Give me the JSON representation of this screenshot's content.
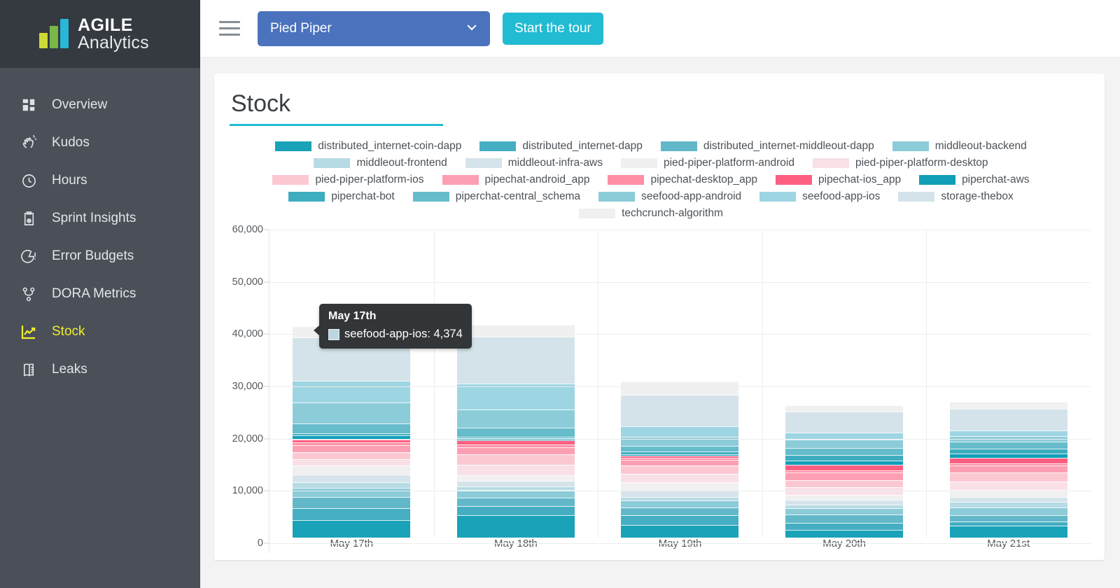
{
  "brand": {
    "line1": "AGILE",
    "line2": "Analytics"
  },
  "sidebar": {
    "items": [
      {
        "label": "Overview",
        "icon": "dashboard-icon",
        "active": false
      },
      {
        "label": "Kudos",
        "icon": "clap-icon",
        "active": false
      },
      {
        "label": "Hours",
        "icon": "clock-icon",
        "active": false
      },
      {
        "label": "Sprint Insights",
        "icon": "clipboard-icon",
        "active": false
      },
      {
        "label": "Error Budgets",
        "icon": "pie-alert-icon",
        "active": false
      },
      {
        "label": "DORA Metrics",
        "icon": "git-branch-icon",
        "active": false
      },
      {
        "label": "Stock",
        "icon": "trend-up-icon",
        "active": true
      },
      {
        "label": "Leaks",
        "icon": "book-icon",
        "active": false
      }
    ]
  },
  "topbar": {
    "menu_icon": "hamburger-icon",
    "project_selected": "Pied Piper",
    "project_chevron": "∨",
    "tour_label": "Start the tour"
  },
  "colors": {
    "accent": "#21bbd2",
    "project_select_bg": "#4a72bd",
    "sidebar_bg": "#4a4f58",
    "brand_bg": "#343a40",
    "active_nav": "#f1ef2c"
  },
  "tooltip": {
    "title": "May 17th",
    "series": "seefood-app-ios",
    "value": "4,374",
    "text": "seefood-app-ios: 4,374",
    "swatch": "#bcd7e0"
  },
  "chart_data": {
    "type": "bar",
    "stacked": true,
    "title": "Stock",
    "xlabel": "",
    "ylabel": "",
    "ylim": [
      0,
      60000
    ],
    "yticks": [
      0,
      10000,
      20000,
      30000,
      40000,
      50000,
      60000
    ],
    "ytick_labels": [
      "0",
      "10,000",
      "20,000",
      "30,000",
      "40,000",
      "50,000",
      "60,000"
    ],
    "grid": true,
    "legend_position": "top",
    "categories": [
      "May 17th",
      "May 18th",
      "May 19th",
      "May 20th",
      "May 21st"
    ],
    "series": [
      {
        "name": "distributed_internet-coin-dapp",
        "color": "#19a2b8",
        "values": [
          3480,
          4550,
          2500,
          1560,
          2420
        ]
      },
      {
        "name": "distributed_internet-dapp",
        "color": "#45aec2",
        "values": [
          2350,
          1740,
          2020,
          1290,
          800
        ]
      },
      {
        "name": "distributed_internet-middleout-dapp",
        "color": "#62b8c8",
        "values": [
          2120,
          1560,
          1500,
          1640,
          1180
        ]
      },
      {
        "name": "middleout-backend",
        "color": "#8ccbd8",
        "values": [
          1830,
          1430,
          1250,
          1280,
          1560
        ]
      },
      {
        "name": "middleout-frontend",
        "color": "#b6dbe5",
        "values": [
          980,
          620,
          620,
          640,
          980
        ]
      },
      {
        "name": "middleout-infra-aws",
        "color": "#d4e4ea",
        "values": [
          1420,
          1020,
          1240,
          800,
          960
        ]
      },
      {
        "name": "pied-piper-platform-android",
        "color": "#f0f0f0",
        "values": [
          1720,
          1080,
          1600,
          920,
          1260
        ]
      },
      {
        "name": "pied-piper-platform-desktop",
        "color": "#f9e0e6",
        "values": [
          1250,
          2020,
          1620,
          1540,
          1720
        ]
      },
      {
        "name": "pied-piper-platform-ios",
        "color": "#fbc8d2",
        "values": [
          1250,
          1990,
          1680,
          1460,
          1760
        ]
      },
      {
        "name": "pipechat-android_app",
        "color": "#fd9fb2",
        "values": [
          1300,
          1310,
          1080,
          1420,
          1420
        ]
      },
      {
        "name": "pipechat-desktop_app",
        "color": "#fe8fa5",
        "values": [
          420,
          470,
          230,
          300,
          290
        ]
      },
      {
        "name": "pipechat-ios_app",
        "color": "#fd5f82",
        "values": [
          480,
          620,
          240,
          1120,
          1080
        ]
      },
      {
        "name": "piperchat-aws",
        "color": "#119fb8",
        "values": [
          700,
          340,
          230,
          680,
          760
        ]
      },
      {
        "name": "piperchat-bot",
        "color": "#3fadc0",
        "values": [
          340,
          230,
          480,
          1180,
          960
        ]
      },
      {
        "name": "piperchat-central_schema",
        "color": "#66bccb",
        "values": [
          1820,
          1620,
          960,
          1340,
          1280
        ]
      },
      {
        "name": "seefood-app-android",
        "color": "#8cccd8",
        "values": [
          4300,
          3680,
          1900,
          1600,
          1120
        ]
      },
      {
        "name": "seefood-app-ios",
        "color": "#9ed5e2",
        "values": [
          4374,
          5280,
          2060,
          1340,
          1020
        ]
      },
      {
        "name": "storage-thebox",
        "color": "#d3e3e9",
        "values": [
          8900,
          9600,
          6500,
          4420,
          4580
        ]
      },
      {
        "name": "techcrunch-algorithm",
        "color": "#f0f0f0",
        "values": [
          2200,
          2240,
          2700,
          1300,
          1340
        ]
      }
    ]
  }
}
